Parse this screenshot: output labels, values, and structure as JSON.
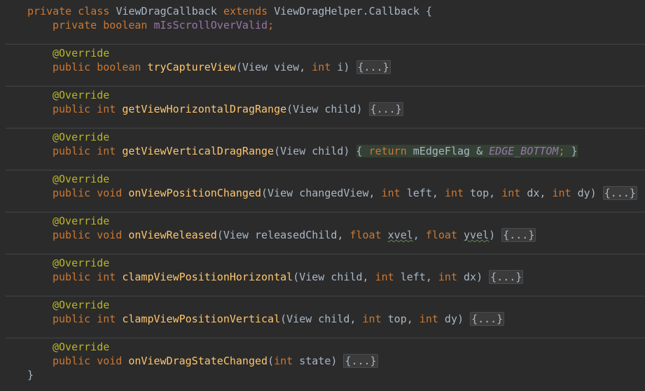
{
  "code": {
    "class_decl": {
      "kw1": "private class ",
      "name": "ViewDragCallback",
      "kw2": " extends ",
      "parent": "ViewDragHelper.Callback {"
    },
    "field_decl": {
      "kw": "private boolean ",
      "name": "mIsScrollOverValid",
      "end": ";"
    },
    "annotation": "@Override",
    "m1": {
      "kw": "public boolean ",
      "name": "tryCaptureView",
      "p1": "(View view, ",
      "k1": "int",
      "p2": " i) ",
      "fold": "{...}"
    },
    "m2": {
      "kw": "public int ",
      "name": "getViewHorizontalDragRange",
      "p1": "(View child) ",
      "fold": "{...}"
    },
    "m3": {
      "kw": "public int ",
      "name": "getViewVerticalDragRange",
      "p1": "(View child) ",
      "brace_open": "{ ",
      "ret": "return ",
      "field": "mEdgeFlag",
      "op": " & ",
      "const": "EDGE_BOTTOM",
      "semi": ";",
      "brace_close": " }"
    },
    "m4": {
      "kw": "public void ",
      "name": "onViewPositionChanged",
      "p1": "(View changedView, ",
      "k1": "int",
      "p2": " left, ",
      "k2": "int",
      "p3": " top, ",
      "k3": "int",
      "p4": " dx, ",
      "k4": "int",
      "p5": " dy) ",
      "fold": "{...}"
    },
    "m5": {
      "kw": "public void ",
      "name": "onViewReleased",
      "p1": "(View releasedChild, ",
      "k1": "float",
      "p2": " ",
      "v1": "xvel",
      "p3": ", ",
      "k2": "float",
      "p4": " ",
      "v2": "yvel",
      "p5": ") ",
      "fold": "{...}"
    },
    "m6": {
      "kw": "public int ",
      "name": "clampViewPositionHorizontal",
      "p1": "(View child, ",
      "k1": "int",
      "p2": " left, ",
      "k2": "int",
      "p3": " dx) ",
      "fold": "{...}"
    },
    "m7": {
      "kw": "public int ",
      "name": "clampViewPositionVertical",
      "p1": "(View child, ",
      "k1": "int",
      "p2": " top, ",
      "k2": "int",
      "p3": " dy) ",
      "fold": "{...}"
    },
    "m8": {
      "kw": "public void ",
      "name": "onViewDragStateChanged",
      "p1": "(",
      "k1": "int",
      "p2": " state) ",
      "fold": "{...}"
    },
    "closing_brace": "}"
  }
}
